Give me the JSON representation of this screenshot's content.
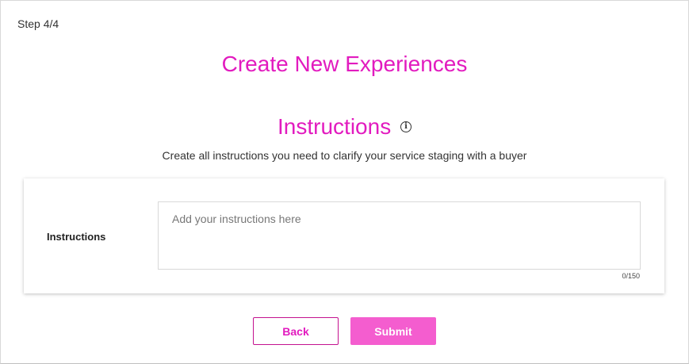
{
  "step": "Step 4/4",
  "title": "Create New Experiences",
  "section": {
    "title": "Instructions",
    "info_icon": "info-icon",
    "description": "Create all instructions you need to clarify your service staging with a buyer"
  },
  "form": {
    "label": "Instructions",
    "value": "",
    "placeholder": "Add your instructions here",
    "counter": "0/150"
  },
  "buttons": {
    "back": "Back",
    "submit": "Submit"
  },
  "colors": {
    "accent": "#e21bbf",
    "submit_bg": "#f45dcf"
  }
}
